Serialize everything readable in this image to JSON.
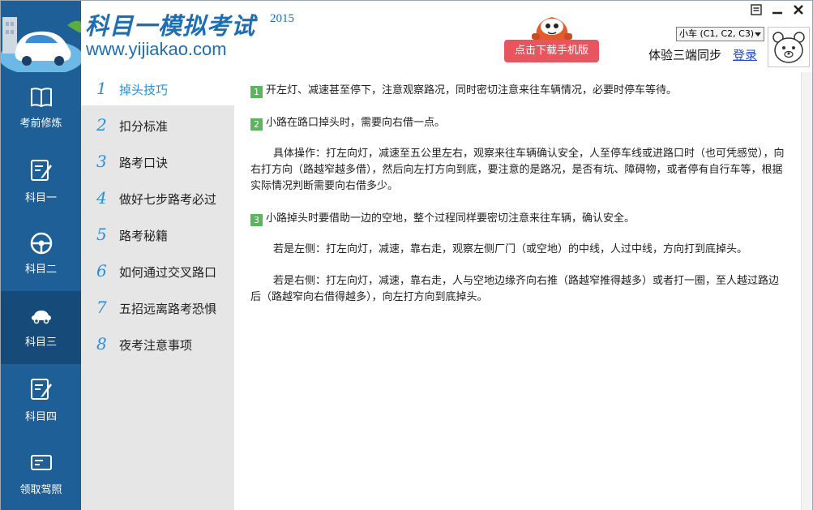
{
  "header": {
    "title": "科目一模拟考试",
    "year": "2015",
    "url": "www.yijiakao.com",
    "download_label": "点击下载手机版",
    "car_type": "小车 (C1, C2, C3)",
    "sync_text": "体验三端同步",
    "login_label": "登录"
  },
  "nav": {
    "items": [
      {
        "label": "考前修炼",
        "icon": "book-icon"
      },
      {
        "label": "科目一",
        "icon": "edit-icon"
      },
      {
        "label": "科目二",
        "icon": "steering-wheel-icon"
      },
      {
        "label": "科目三",
        "icon": "car-icon",
        "active": true
      },
      {
        "label": "科目四",
        "icon": "edit-icon"
      },
      {
        "label": "领取驾照",
        "icon": "license-card-icon"
      }
    ]
  },
  "submenu": {
    "items": [
      {
        "num": "1",
        "label": "掉头技巧",
        "active": true
      },
      {
        "num": "2",
        "label": "扣分标准"
      },
      {
        "num": "3",
        "label": "路考口诀"
      },
      {
        "num": "4",
        "label": "做好七步路考必过"
      },
      {
        "num": "5",
        "label": "路考秘籍"
      },
      {
        "num": "6",
        "label": "如何通过交叉路口"
      },
      {
        "num": "7",
        "label": "五招远离路考恐惧"
      },
      {
        "num": "8",
        "label": "夜考注意事项"
      }
    ]
  },
  "content": {
    "p1_badge": "1",
    "p1": "开左灯、减速甚至停下，注意观察路况，同时密切注意来往车辆情况，必要时停车等待。",
    "p2_badge": "2",
    "p2": "小路在路口掉头时，需要向右借一点。",
    "p3": "具体操作：打左向灯，减速至五公里左右，观察来往车辆确认安全，人至停车线或进路口时（也可凭感觉），向右打方向（路越窄越多借），然后向左打方向到底，要注意的是路况，是否有坑、障碍物，或者停有自行车等，根据实际情况判断需要向右借多少。",
    "p4_badge": "3",
    "p4": "小路掉头时要借助一边的空地，整个过程同样要密切注意来往车辆，确认安全。",
    "p5": "若是左侧：打左向灯，减速，靠右走，观察左侧厂门（或空地）的中线，人过中线，方向打到底掉头。",
    "p6": "若是右侧：打左向灯，减速，靠右走，人与空地边缘齐向右推（路越窄推得越多）或者打一圈，至人越过路边后（路越窄向右借得越多），向左打方向到底掉头。"
  },
  "colors": {
    "nav_bg": "#1e5f97",
    "nav_active": "#164a78",
    "accent_blue": "#2c8fd6",
    "download_red": "#e9555f",
    "badge_green": "#5bb55c"
  }
}
